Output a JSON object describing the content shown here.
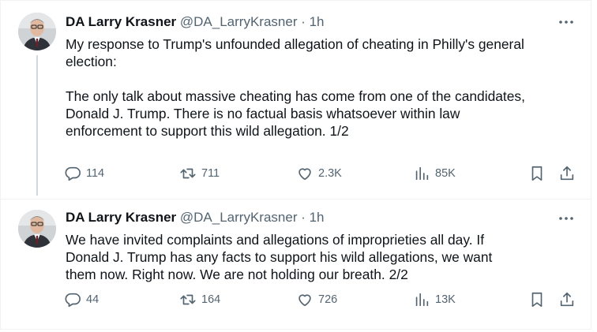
{
  "tweets": [
    {
      "author_name": "DA Larry Krasner",
      "handle": "@DA_LarryKrasner",
      "separator": " · ",
      "time": "1h",
      "text": "My response to Trump's unfounded allegation of cheating in Philly's general\nelection:\n\nThe only talk about massive cheating has come from one of the candidates,\nDonald J. Trump. There is no factual basis whatsoever within law\nenforcement to support this wild allegation. 1/2",
      "replies": "114",
      "retweets": "711",
      "likes": "2.3K",
      "views": "85K"
    },
    {
      "author_name": "DA Larry Krasner",
      "handle": "@DA_LarryKrasner",
      "separator": " · ",
      "time": "1h",
      "text": "We have invited complaints and allegations of improprieties all day. If\nDonald J. Trump has any facts to support his wild allegations, we want\nthem now. Right now. We are not holding our breath. 2/2",
      "replies": "44",
      "retweets": "164",
      "likes": "726",
      "views": "13K"
    }
  ],
  "icons": {
    "reply": "reply-icon",
    "retweet": "retweet-icon",
    "like": "heart-icon",
    "views": "views-icon",
    "bookmark": "bookmark-icon",
    "share": "share-icon",
    "more": "more-icon"
  },
  "colors": {
    "text": "#0f1419",
    "muted": "#536471",
    "border": "#eff3f4",
    "thread_line": "#cfd9de"
  }
}
